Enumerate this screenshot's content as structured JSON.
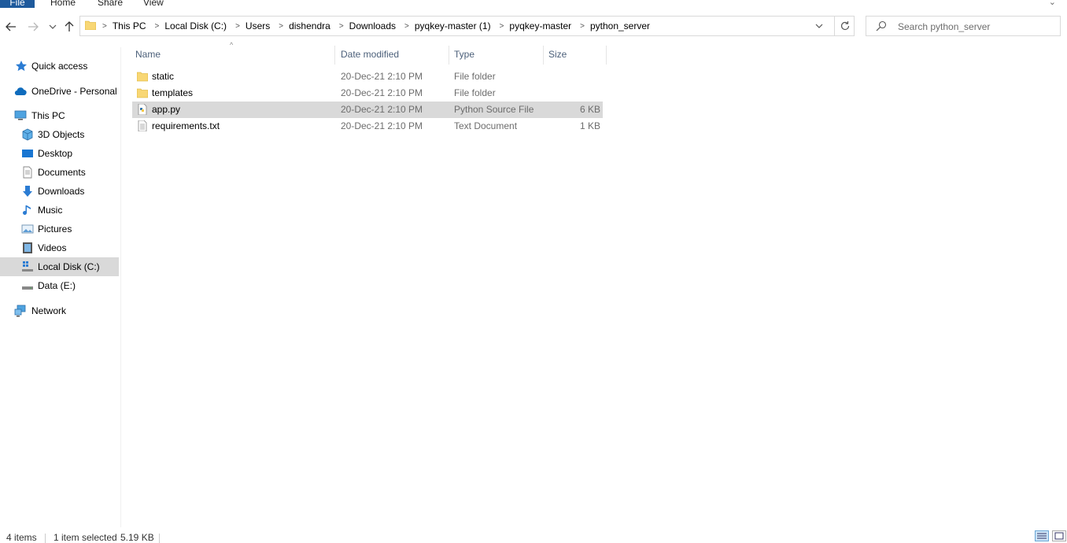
{
  "ribbon": {
    "tabs": [
      "File",
      "Home",
      "Share",
      "View"
    ]
  },
  "address": {
    "breadcrumbs": [
      "This PC",
      "Local Disk (C:)",
      "Users",
      "dishendra",
      "Downloads",
      "pyqkey-master (1)",
      "pyqkey-master",
      "python_server"
    ]
  },
  "search": {
    "placeholder": "Search python_server"
  },
  "sidebar": {
    "items": [
      {
        "label": "Quick access",
        "icon": "star-icon"
      },
      {
        "label": "OneDrive - Personal",
        "icon": "cloud-icon"
      },
      {
        "label": "This PC",
        "icon": "computer-icon"
      },
      {
        "label": "3D Objects",
        "icon": "cube-icon"
      },
      {
        "label": "Desktop",
        "icon": "desktop-icon"
      },
      {
        "label": "Documents",
        "icon": "document-icon"
      },
      {
        "label": "Downloads",
        "icon": "download-arrow-icon"
      },
      {
        "label": "Music",
        "icon": "music-note-icon"
      },
      {
        "label": "Pictures",
        "icon": "picture-icon"
      },
      {
        "label": "Videos",
        "icon": "film-icon"
      },
      {
        "label": "Local Disk (C:)",
        "icon": "windows-drive-icon",
        "selected": true
      },
      {
        "label": "Data (E:)",
        "icon": "drive-icon"
      },
      {
        "label": "Network",
        "icon": "network-icon"
      }
    ]
  },
  "columns": {
    "name": "Name",
    "date": "Date modified",
    "type": "Type",
    "size": "Size"
  },
  "files": [
    {
      "name": "static",
      "date": "20-Dec-21 2:10 PM",
      "type": "File folder",
      "size": "",
      "icon": "folder-icon"
    },
    {
      "name": "templates",
      "date": "20-Dec-21 2:10 PM",
      "type": "File folder",
      "size": "",
      "icon": "folder-icon"
    },
    {
      "name": "app.py",
      "date": "20-Dec-21 2:10 PM",
      "type": "Python Source File",
      "size": "6 KB",
      "icon": "python-file-icon",
      "selected": true
    },
    {
      "name": "requirements.txt",
      "date": "20-Dec-21 2:10 PM",
      "type": "Text Document",
      "size": "1 KB",
      "icon": "text-file-icon"
    }
  ],
  "status": {
    "item_count": "4 items",
    "selection": "1 item selected",
    "selection_size": "5.19 KB"
  },
  "colors": {
    "selected_bg": "#d9d9d9",
    "file_tab": "#1e5a9c",
    "folder": "#f8d775",
    "accent": "#0078d7"
  }
}
